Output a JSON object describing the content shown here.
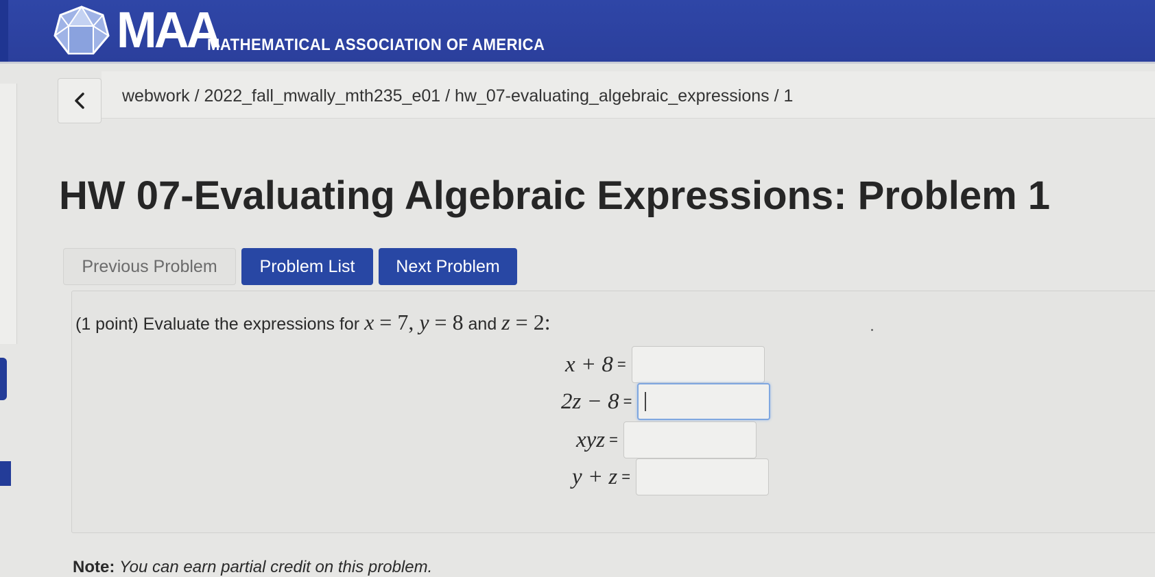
{
  "header": {
    "logo_text": "MAA",
    "org_name": "MATHEMATICAL ASSOCIATION OF AMERICA",
    "brand_color": "#2f46a7"
  },
  "breadcrumb": {
    "back_icon": "chevron-left-icon",
    "path": "webwork / 2022_fall_mwally_mth235_e01 / hw_07-evaluating_algebraic_expressions / 1"
  },
  "page_title": "HW 07-Evaluating Algebraic Expressions: Problem 1",
  "nav": {
    "previous": "Previous Problem",
    "list": "Problem List",
    "next": "Next Problem"
  },
  "problem": {
    "points": "(1 point) Evaluate the expressions for",
    "x_name": "x",
    "x_value": "7",
    "y_name": "y",
    "y_value": "8",
    "and_word": "and",
    "z_name": "z",
    "z_value": "2",
    "rows": [
      {
        "expr": "x + 8",
        "eq": "=",
        "value": ""
      },
      {
        "expr": "2z − 8",
        "eq": "=",
        "value": ""
      },
      {
        "expr": "xyz",
        "eq": "=",
        "value": ""
      },
      {
        "expr": "y + z",
        "eq": "=",
        "value": ""
      }
    ]
  },
  "note": {
    "label": "Note:",
    "text": "You can earn partial credit on this problem."
  }
}
